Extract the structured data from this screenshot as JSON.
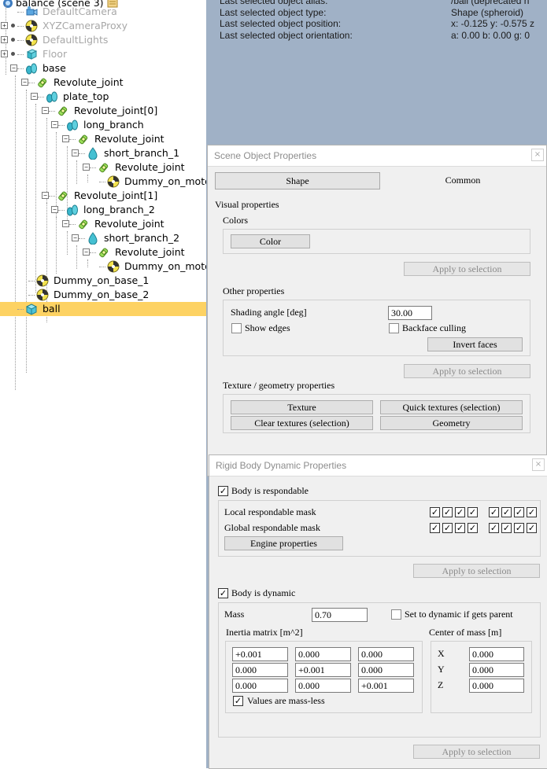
{
  "hierarchy": {
    "root_label": "balance (scene 3)",
    "items": [
      {
        "label": "DefaultCamera",
        "icon": "camera-icon",
        "dim": true
      },
      {
        "label": "XYZCameraProxy",
        "icon": "dummy-icon",
        "dim": true
      },
      {
        "label": "DefaultLights",
        "icon": "dummy-icon",
        "dim": true
      },
      {
        "label": "Floor",
        "icon": "cuboid-icon",
        "dim": true
      },
      {
        "label": "base",
        "icon": "shape-group-icon",
        "dim": false
      },
      {
        "label": "Revolute_joint",
        "icon": "joint-icon",
        "dim": false
      },
      {
        "label": "plate_top",
        "icon": "shape-group-icon",
        "dim": false
      },
      {
        "label": "Revolute_joint[0]",
        "icon": "joint-icon",
        "dim": false
      },
      {
        "label": "long_branch",
        "icon": "shape-group-icon",
        "dim": false
      },
      {
        "label": "Revolute_joint",
        "icon": "joint-icon",
        "dim": false
      },
      {
        "label": "short_branch_1",
        "icon": "shape-icon",
        "dim": false
      },
      {
        "label": "Revolute_joint",
        "icon": "joint-icon",
        "dim": false
      },
      {
        "label": "Dummy_on_moto",
        "icon": "dummy-icon",
        "dim": false
      },
      {
        "label": "Revolute_joint[1]",
        "icon": "joint-icon",
        "dim": false
      },
      {
        "label": "long_branch_2",
        "icon": "shape-group-icon",
        "dim": false
      },
      {
        "label": "Revolute_joint",
        "icon": "joint-icon",
        "dim": false
      },
      {
        "label": "short_branch_2",
        "icon": "shape-icon",
        "dim": false
      },
      {
        "label": "Revolute_joint",
        "icon": "joint-icon",
        "dim": false
      },
      {
        "label": "Dummy_on_moto",
        "icon": "dummy-icon",
        "dim": false
      },
      {
        "label": "Dummy_on_base_1",
        "icon": "dummy-icon",
        "dim": false
      },
      {
        "label": "Dummy_on_base_2",
        "icon": "dummy-icon",
        "dim": false
      },
      {
        "label": "ball",
        "icon": "sphere-icon",
        "dim": false,
        "selected": true
      }
    ]
  },
  "info": {
    "lines": [
      {
        "label": "Last selected object alias:",
        "value": "/ball   (deprecated n"
      },
      {
        "label": "Last selected object type:",
        "value": "Shape (spheroid)"
      },
      {
        "label": "Last selected object position:",
        "value": "x: -0.125    y: -0.575    z"
      },
      {
        "label": "Last selected object orientation:",
        "value": "a: 0.00    b: 0.00    g: 0"
      }
    ]
  },
  "scene_props": {
    "title": "Scene Object Properties",
    "close": "×",
    "tabs": [
      "Shape",
      "Common"
    ],
    "visual_title": "Visual properties",
    "colors_title": "Colors",
    "color_button": "Color",
    "apply1": "Apply to selection",
    "other_title": "Other properties",
    "shading_label": "Shading angle [deg]",
    "shading_value": "30.00",
    "show_edges": "Show edges",
    "backface": "Backface culling",
    "invert_faces": "Invert faces",
    "apply2": "Apply to selection",
    "texture_title": "Texture / geometry properties",
    "texture_btn": "Texture",
    "quick_textures_btn": "Quick textures (selection)",
    "clear_textures_btn": "Clear textures (selection)",
    "geometry_btn": "Geometry"
  },
  "rigid_props": {
    "title": "Rigid Body Dynamic Properties",
    "close": "×",
    "body_respondable": "Body is respondable",
    "local_mask": "Local respondable mask",
    "global_mask": "Global respondable mask",
    "engine_props": "Engine properties",
    "apply1": "Apply to selection",
    "body_dynamic": "Body is dynamic",
    "mass_label": "Mass",
    "mass_value": "0.70",
    "set_dynamic": "Set to dynamic if gets parent",
    "inertia_label": "Inertia matrix [m^2]",
    "com_label": "Center of mass [m]",
    "inertia": [
      "+0.001",
      "0.000",
      "0.000",
      "0.000",
      "+0.001",
      "0.000",
      "0.000",
      "0.000",
      "+0.001"
    ],
    "mass_less": "Values are mass-less",
    "com_x_label": "X",
    "com_y_label": "Y",
    "com_z_label": "Z",
    "com_x": "0.000",
    "com_y": "0.000",
    "com_z": "0.000",
    "apply2": "Apply to selection"
  },
  "colors": {
    "viewport": "#a0b1c6",
    "selection": "#fdd263"
  }
}
